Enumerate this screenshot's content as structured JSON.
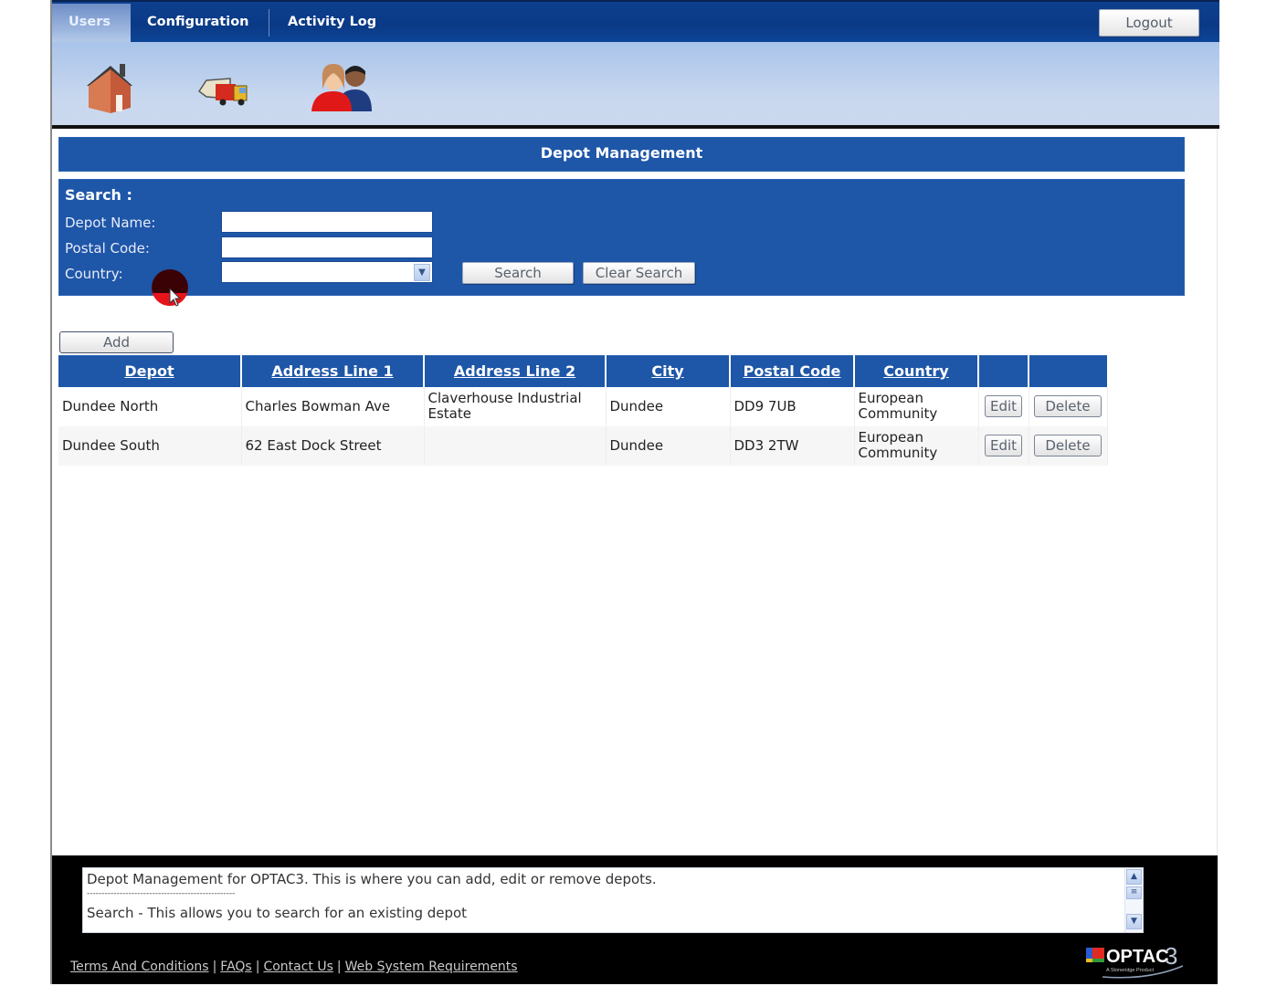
{
  "nav": {
    "tabs": [
      {
        "label": "Users",
        "active": true
      },
      {
        "label": "Configuration",
        "active": false
      },
      {
        "label": "Activity Log",
        "active": false
      }
    ],
    "logout_label": "Logout",
    "icons": [
      "home-icon",
      "vehicle-icon",
      "people-icon"
    ]
  },
  "page": {
    "title": "Depot Management"
  },
  "search": {
    "heading": "Search :",
    "fields": {
      "depot_name": {
        "label": "Depot Name:",
        "value": ""
      },
      "postal_code": {
        "label": "Postal Code:",
        "value": ""
      },
      "country": {
        "label": "Country:",
        "selected": ""
      }
    },
    "search_label": "Search",
    "clear_label": "Clear Search"
  },
  "table": {
    "add_label": "Add",
    "columns": [
      "Depot",
      "Address Line 1",
      "Address Line 2",
      "City",
      "Postal Code",
      "Country",
      "",
      ""
    ],
    "rows": [
      {
        "depot": "Dundee North",
        "address1": "Charles Bowman Ave",
        "address2": "Claverhouse Industrial Estate",
        "city": "Dundee",
        "postal_code": "DD9 7UB",
        "country": "European Community",
        "edit_label": "Edit",
        "delete_label": "Delete"
      },
      {
        "depot": "Dundee South",
        "address1": "62 East Dock Street",
        "address2": "",
        "city": "Dundee",
        "postal_code": "DD3 2TW",
        "country": "European Community",
        "edit_label": "Edit",
        "delete_label": "Delete"
      }
    ]
  },
  "help": {
    "line1": "Depot Management for OPTAC3. This is where you can add, edit or remove depots.",
    "divider": "--------------------------------------------------",
    "line2": "Search - This allows you to search for an existing depot"
  },
  "footer": {
    "links": [
      "Terms And Conditions",
      "FAQs",
      "Contact Us",
      "Web System Requirements"
    ],
    "separator": "|",
    "brand": "OPTAC",
    "brand_suffix": "3",
    "brand_tagline": "A Stoneridge Product"
  },
  "colors": {
    "primary_blue": "#1e56a8",
    "nav_blue": "#0a3a86",
    "footer_black": "#000000"
  }
}
